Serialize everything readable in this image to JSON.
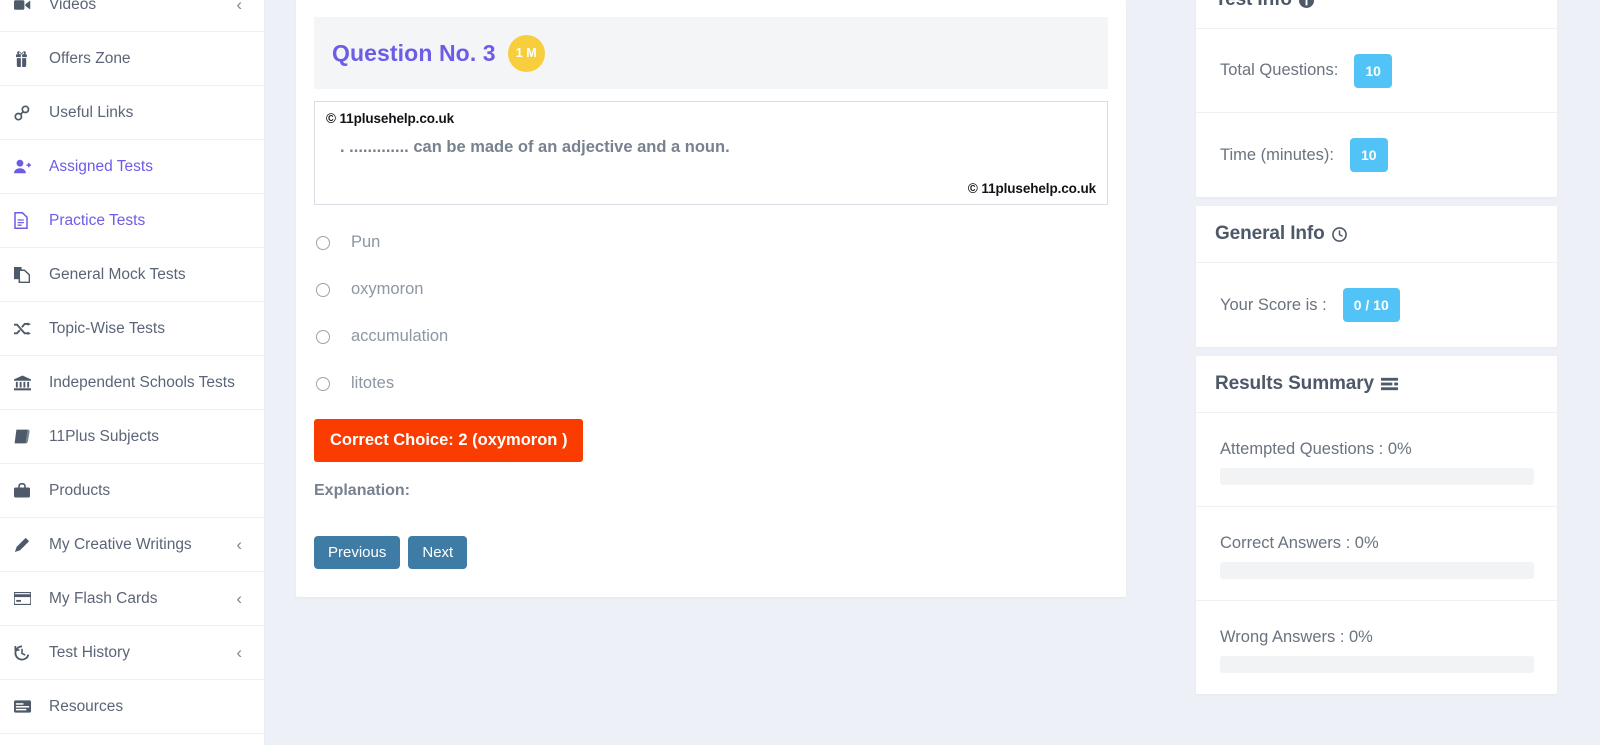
{
  "sidebar": {
    "items": [
      {
        "label": "Videos",
        "icon": "video-camera-icon",
        "chevron": "‹",
        "active": false
      },
      {
        "label": "Offers Zone",
        "icon": "gift-icon",
        "chevron": "",
        "active": false
      },
      {
        "label": "Useful Links",
        "icon": "link-chain-icon",
        "chevron": "",
        "active": false
      },
      {
        "label": "Assigned Tests",
        "icon": "user-plus-icon",
        "chevron": "",
        "active": true
      },
      {
        "label": "Practice Tests",
        "icon": "document-icon",
        "chevron": "",
        "active": true
      },
      {
        "label": "General Mock Tests",
        "icon": "copy-files-icon",
        "chevron": "",
        "active": false
      },
      {
        "label": "Topic-Wise Tests",
        "icon": "shuffle-icon",
        "chevron": "",
        "active": false
      },
      {
        "label": "Independent Schools Tests",
        "icon": "bank-icon",
        "chevron": "",
        "active": false
      },
      {
        "label": "11Plus Subjects",
        "icon": "book-icon",
        "chevron": "",
        "active": false
      },
      {
        "label": "Products",
        "icon": "briefcase-icon",
        "chevron": "",
        "active": false
      },
      {
        "label": "My Creative Writings",
        "icon": "pencil-icon",
        "chevron": "‹",
        "active": false
      },
      {
        "label": "My Flash Cards",
        "icon": "credit-card-icon",
        "chevron": "‹",
        "active": false
      },
      {
        "label": "Test History",
        "icon": "history-clock-icon",
        "chevron": "‹",
        "active": false
      },
      {
        "label": "Resources",
        "icon": "resources-icon",
        "chevron": "",
        "active": false
      }
    ]
  },
  "question": {
    "title": "Question No. 3",
    "marks_badge": "1 M",
    "copyright_top": "© 11plusehelp.co.uk",
    "copyright_bottom": "© 11plusehelp.co.uk",
    "text": ". ............. can be made of an adjective and a noun.",
    "options": [
      {
        "label": "Pun",
        "selected": false
      },
      {
        "label": "oxymoron",
        "selected": false
      },
      {
        "label": "accumulation",
        "selected": false
      },
      {
        "label": "litotes",
        "selected": false
      }
    ],
    "correct_choice_label": "Correct Choice: 2 (oxymoron )",
    "correct_choice_color": "#fa3c00",
    "explanation_label": "Explanation:",
    "explanation_text": "",
    "previous_label": "Previous",
    "next_label": "Next"
  },
  "test_info": {
    "title": "Test Info",
    "icon": "info-circle-icon",
    "rows": [
      {
        "label": "Total Questions:",
        "value": "10"
      },
      {
        "label": "Time (minutes):",
        "value": "10"
      }
    ]
  },
  "general_info": {
    "title": "General Info",
    "icon": "clock-circle-icon",
    "rows": [
      {
        "label": "Your Score is :",
        "value": "0 / 10"
      }
    ]
  },
  "results_summary": {
    "title": "Results Summary",
    "icon": "list-bars-icon",
    "bars": [
      {
        "label": "Attempted Questions : 0%",
        "percent": 0
      },
      {
        "label": "Correct Answers : 0%",
        "percent": 0
      },
      {
        "label": "Wrong Answers : 0%",
        "percent": 0
      }
    ]
  },
  "colors": {
    "accent_purple": "#6c5ce7",
    "badge_yellow": "#f7ce3e",
    "pill_blue": "#52c3f7",
    "correct_red": "#fa3c00",
    "nav_button_blue": "#3f7ca5",
    "page_bg": "#edf1f7"
  }
}
